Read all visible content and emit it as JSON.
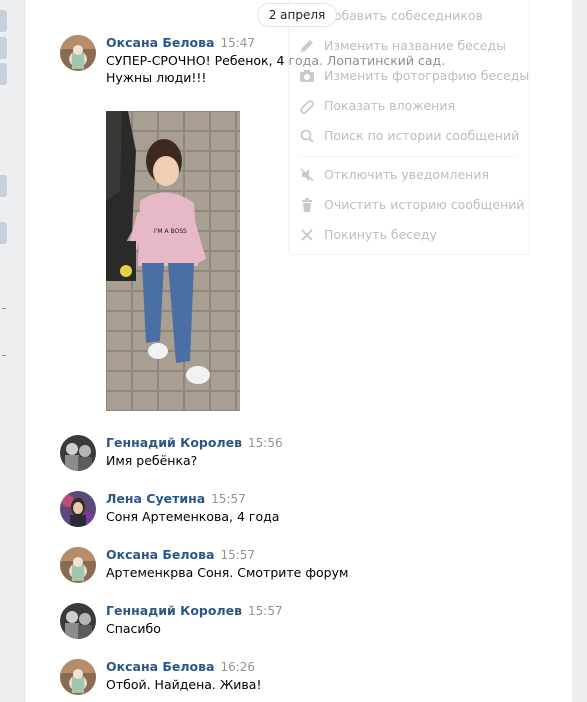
{
  "date_divider": "2 апреля",
  "menu": {
    "items_top": [
      {
        "label": "Добавить собеседников",
        "icon": "add-user-icon"
      },
      {
        "label": "Изменить название беседы",
        "icon": "pencil-icon"
      },
      {
        "label": "Изменить фотографию беседы",
        "icon": "camera-icon"
      },
      {
        "label": "Показать вложения",
        "icon": "paperclip-icon"
      },
      {
        "label": "Поиск по истории сообщений",
        "icon": "search-icon"
      }
    ],
    "items_bottom": [
      {
        "label": "Отключить уведомления",
        "icon": "mute-icon"
      },
      {
        "label": "Очистить историю сообщений",
        "icon": "trash-icon"
      },
      {
        "label": "Покинуть беседу",
        "icon": "close-icon"
      }
    ]
  },
  "messages": [
    {
      "author": "Оксана Белова",
      "time": "15:47",
      "text": "СУПЕР-СРОЧНО! Ребенок, 4 года. Лопатинский сад. Нужны люди!!!",
      "has_photo": true
    },
    {
      "author": "Геннадий Королев",
      "time": "15:56",
      "text": "Имя ребёнка?"
    },
    {
      "author": "Лена Суетина",
      "time": "15:57",
      "text": "Соня Артеменкова, 4 года"
    },
    {
      "author": "Оксана Белова",
      "time": "15:57",
      "text": "Артеменкрва Соня. Смотрите форум"
    },
    {
      "author": "Геннадий Королев",
      "time": "15:57",
      "text": "Спасибо"
    },
    {
      "author": "Оксана Белова",
      "time": "16:26",
      "text": "Отбой. Найдена. Жива!"
    }
  ],
  "photo": {
    "shirt_text": "I'M A BOSS"
  },
  "colors": {
    "author_link": "#2a5885",
    "time_gray": "#939393",
    "menu_text": "#7c8a99",
    "background": "#edeef0"
  }
}
